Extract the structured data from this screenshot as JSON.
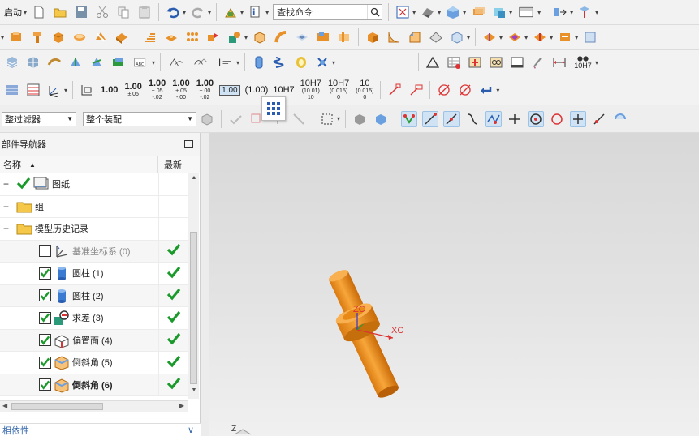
{
  "toolbar1": {
    "start_label": "启动",
    "search_placeholder": "查找命令"
  },
  "toolbar4": {
    "tolerances": [
      {
        "main": "1.00",
        "sub1": "",
        "sub2": ""
      },
      {
        "main": "1.00",
        "sub1": "±.05",
        "sub2": ""
      },
      {
        "main": "1.00",
        "sub1": "+.05",
        "sub2": "-.02"
      },
      {
        "main": "1.00",
        "sub1": "+.05",
        "sub2": "-.00"
      },
      {
        "main": "1.00",
        "sub1": "+.00",
        "sub2": "-.02"
      }
    ],
    "boxed": "1.00",
    "paren": "(1.00)",
    "fit1": "10H7",
    "fit2": {
      "main": "10H7",
      "sub1": "(10.01)",
      "sub2": "10"
    },
    "fit3": {
      "main": "10H7",
      "sub1": "(0.015)",
      "sub2": "0"
    },
    "fit4": {
      "main": "10",
      "sub1": "(0.015)",
      "sub2": "0"
    },
    "binocular_label": "10H7"
  },
  "filters": {
    "selection_filter": "整过滤器",
    "assembly_scope": "整个装配"
  },
  "navigator": {
    "title": "部件导航器",
    "col_name": "名称",
    "col_latest": "最新",
    "rows": [
      {
        "label": "图纸",
        "expander": "+",
        "type": "drawing"
      },
      {
        "label": "组",
        "expander": "+",
        "type": "folder"
      },
      {
        "label": "模型历史记录",
        "expander": "−",
        "type": "folder"
      },
      {
        "label": "基准坐标系 (0)",
        "type": "datum",
        "checked": false,
        "latest": true
      },
      {
        "label": "圆柱 (1)",
        "type": "cylinder",
        "checked": true,
        "latest": true
      },
      {
        "label": "圆柱 (2)",
        "type": "cylinder",
        "checked": true,
        "latest": true
      },
      {
        "label": "求差 (3)",
        "type": "subtract",
        "checked": true,
        "latest": true
      },
      {
        "label": "偏置面 (4)",
        "type": "offset",
        "checked": true,
        "latest": true
      },
      {
        "label": "倒斜角 (5)",
        "type": "chamfer",
        "checked": true,
        "latest": true
      },
      {
        "label": "倒斜角 (6)",
        "type": "chamfer",
        "checked": true,
        "latest": true
      }
    ],
    "dependency_label": "相依性"
  },
  "viewport": {
    "zc_label": "ZC",
    "xc_label": "XC",
    "z_corner_label": "Z",
    "colors": {
      "part": "#f0961e",
      "part_dark": "#c56e0c"
    }
  }
}
